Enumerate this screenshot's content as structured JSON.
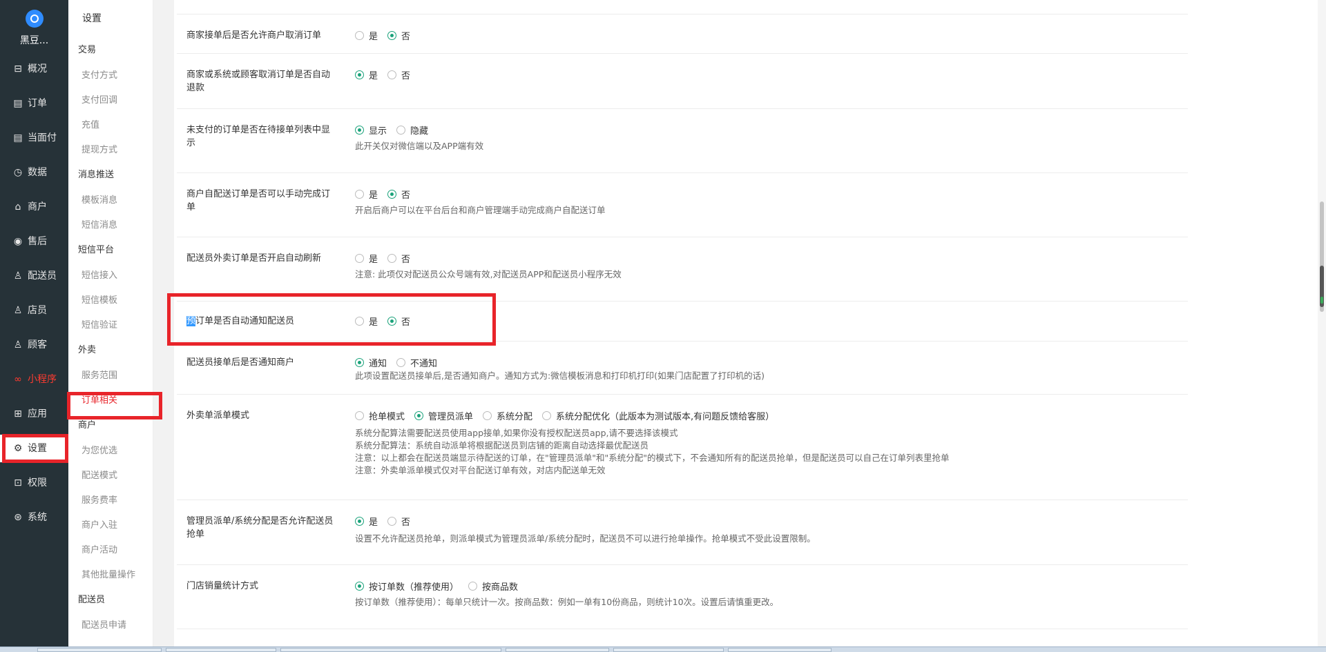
{
  "brand": {
    "name": "黑豆..."
  },
  "nav": [
    {
      "label": "概况",
      "icon": "dashboard-icon",
      "glyph": "⊟"
    },
    {
      "label": "订单",
      "icon": "order-icon",
      "glyph": "▤"
    },
    {
      "label": "当面付",
      "icon": "face-pay-icon",
      "glyph": "▤"
    },
    {
      "label": "数据",
      "icon": "data-icon",
      "glyph": "◷"
    },
    {
      "label": "商户",
      "icon": "merchant-icon",
      "glyph": "⌂"
    },
    {
      "label": "售后",
      "icon": "after-sale-icon",
      "glyph": "◉"
    },
    {
      "label": "配送员",
      "icon": "courier-icon",
      "glyph": "♙"
    },
    {
      "label": "店员",
      "icon": "clerk-icon",
      "glyph": "♙"
    },
    {
      "label": "顾客",
      "icon": "customer-icon",
      "glyph": "♙"
    },
    {
      "label": "小程序",
      "icon": "mini-program-icon",
      "glyph": "∞"
    },
    {
      "label": "应用",
      "icon": "apps-icon",
      "glyph": "⊞"
    },
    {
      "label": "设置",
      "icon": "gear-icon",
      "glyph": "⚙"
    },
    {
      "label": "权限",
      "icon": "lock-icon",
      "glyph": "⊡"
    },
    {
      "label": "系统",
      "icon": "system-icon",
      "glyph": "⊛"
    }
  ],
  "sub": {
    "title": "设置",
    "groups": [
      {
        "label": "交易",
        "items": [
          "支付方式",
          "支付回调",
          "充值",
          "提现方式"
        ]
      },
      {
        "label": "消息推送",
        "items": [
          "模板消息",
          "短信消息"
        ]
      },
      {
        "label": "短信平台",
        "items": [
          "短信接入",
          "短信模板",
          "短信验证"
        ]
      },
      {
        "label": "外卖",
        "items": [
          "服务范围",
          "订单相关"
        ]
      },
      {
        "label": "商户",
        "items": [
          "为您优选",
          "配送模式",
          "服务费率",
          "商户入驻",
          "商户活动",
          "其他批量操作"
        ]
      },
      {
        "label": "配送员",
        "items": [
          "配送员申请"
        ]
      }
    ]
  },
  "settings": [
    {
      "label": "商家接单后是否允许商户取消订单",
      "options": [
        "是",
        "否"
      ],
      "selected": 1,
      "notes": []
    },
    {
      "label": "商家或系统或顾客取消订单是否自动退款",
      "options": [
        "是",
        "否"
      ],
      "selected": 0,
      "notes": []
    },
    {
      "label": "未支付的订单是否在待接单列表中显示",
      "options": [
        "显示",
        "隐藏"
      ],
      "selected": 0,
      "notes": [
        "此开关仅对微信端以及APP端有效"
      ]
    },
    {
      "label": "商户自配送订单是否可以手动完成订单",
      "options": [
        "是",
        "否"
      ],
      "selected": 1,
      "notes": [
        "开启后商户可以在平台后台和商户管理端手动完成商户自配送订单"
      ]
    },
    {
      "label": "配送员外卖订单是否开启自动刷新",
      "options": [
        "是",
        "否"
      ],
      "selected": -1,
      "notes": [
        "注意: 此项仅对配送员公众号端有效,对配送员APP和配送员小程序无效"
      ]
    },
    {
      "label_hl": "预",
      "label": "订单是否自动通知配送员",
      "options": [
        "是",
        "否"
      ],
      "selected": 1,
      "notes": []
    },
    {
      "label": "配送员接单后是否通知商户",
      "options": [
        "通知",
        "不通知"
      ],
      "selected": 0,
      "notes": [
        "此项设置配送员接单后,是否通知商户。通知方式为:微信模板消息和打印机打印(如果门店配置了打印机的话)"
      ]
    },
    {
      "label": "外卖单派单模式",
      "options": [
        "抢单模式",
        "管理员派单",
        "系统分配",
        "系统分配优化（此版本为测试版本,有问题反馈给客服）"
      ],
      "selected": 1,
      "notes": [
        "系统分配算法需要配送员使用app接单,如果你没有授权配送员app,请不要选择该模式",
        "系统分配算法：系统自动派单将根据配送员到店铺的距离自动选择最优配送员",
        "注意：以上都会在配送员端显示待配送的订单，在\"管理员派单\"和\"系统分配\"的模式下，不会通知所有的配送员抢单，但是配送员可以自己在订单列表里抢单",
        "注意：外卖单派单模式仅对平台配送订单有效，对店内配送单无效"
      ]
    },
    {
      "label": "管理员派单/系统分配是否允许配送员抢单",
      "options": [
        "是",
        "否"
      ],
      "selected": 0,
      "notes": [
        "设置不允许配送员抢单，则派单模式为管理员派单/系统分配时，配送员不可以进行抢单操作。抢单模式不受此设置限制。"
      ]
    },
    {
      "label": "门店销量统计方式",
      "options": [
        "按订单数（推荐使用）",
        "按商品数"
      ],
      "selected": 0,
      "notes": [
        "按订单数（推荐使用）：每单只统计一次。按商品数：例如一单有10份商品，则统计10次。设置后请慎重更改。"
      ]
    }
  ],
  "colors": {
    "accent": "#1aa27a",
    "highlight": "#e8242a",
    "nav_bg": "#263238"
  }
}
